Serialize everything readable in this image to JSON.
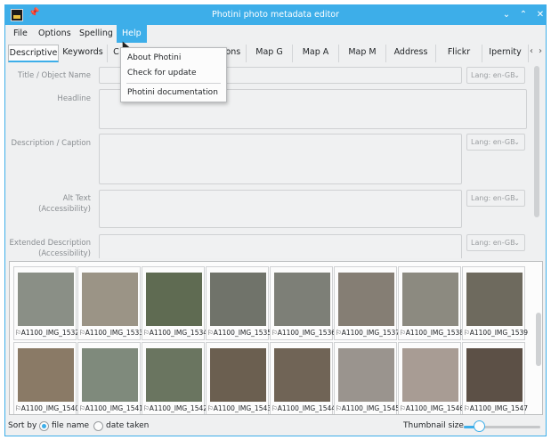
{
  "window": {
    "title": "Photini photo metadata editor"
  },
  "menubar": {
    "items": [
      "File",
      "Options",
      "Spelling",
      "Help"
    ],
    "active": "Help"
  },
  "help_menu": {
    "items": [
      "About Photini",
      "Check for update",
      "Photini documentation"
    ]
  },
  "tabs": {
    "items": [
      "Descriptive",
      "Keywords",
      "C",
      "Regions",
      "Map G",
      "Map A",
      "Map M",
      "Address",
      "Flickr",
      "Ipernity"
    ],
    "active": "Descriptive"
  },
  "form": {
    "title_label": "Title / Object Name",
    "headline_label": "Headline",
    "description_label": "Description / Caption",
    "alt_text_label_1": "Alt Text",
    "alt_text_label_2": "(Accessibility)",
    "extended_label_1": "Extended Description",
    "extended_label_2": "(Accessibility)",
    "lang_value": "Lang: en-GB"
  },
  "thumbnails": [
    "A1100_IMG_1532",
    "A1100_IMG_1533",
    "A1100_IMG_1534",
    "A1100_IMG_1535",
    "A1100_IMG_1536",
    "A1100_IMG_1537",
    "A1100_IMG_1538",
    "A1100_IMG_1539",
    "A1100_IMG_1540",
    "A1100_IMG_1541",
    "A1100_IMG_1542",
    "A1100_IMG_1543",
    "A1100_IMG_1544",
    "A1100_IMG_1545",
    "A1100_IMG_1546",
    "A1100_IMG_1547"
  ],
  "bottom": {
    "sort_label": "Sort by",
    "sort_options": [
      "file name",
      "date taken"
    ],
    "sort_selected": "file name",
    "thumb_size_label": "Thumbnail size",
    "thumb_size_fraction": 0.2
  },
  "colors": {
    "accent": "#3daee9",
    "window_bg": "#eff0f1"
  }
}
